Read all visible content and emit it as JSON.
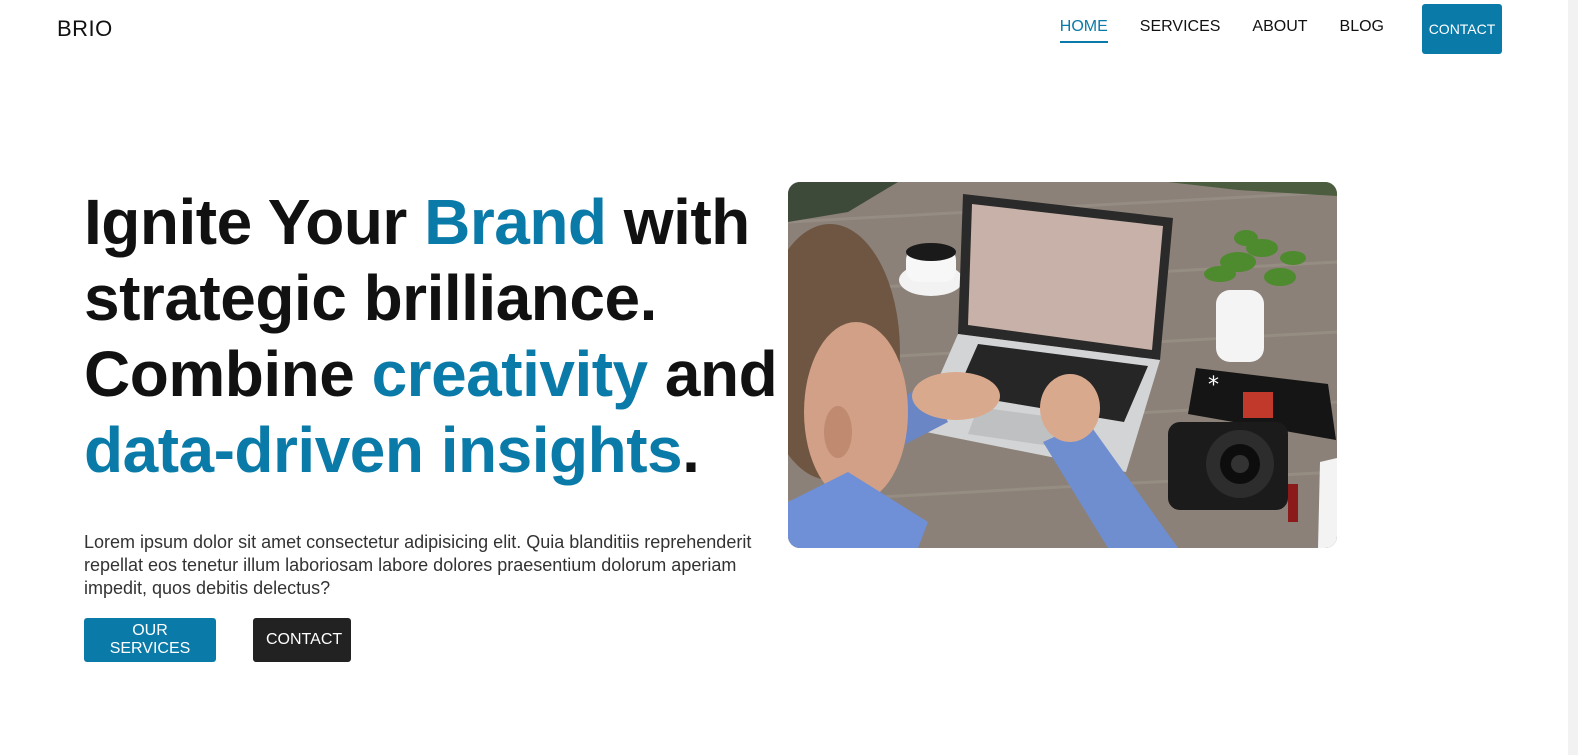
{
  "header": {
    "brand": "BRIO",
    "nav": [
      {
        "label": "HOME",
        "active": true
      },
      {
        "label": "SERVICES",
        "active": false
      },
      {
        "label": "ABOUT",
        "active": false
      },
      {
        "label": "BLOG",
        "active": false
      }
    ],
    "contact_label": "CONTACT"
  },
  "hero": {
    "heading": {
      "part1": "Ignite Your ",
      "hl1": "Brand",
      "part2": " with strategic brilliance. Combine ",
      "hl2": "creativity",
      "part3": " and ",
      "hl3": "data-driven insights",
      "part4": "."
    },
    "description": "Lorem ipsum dolor sit amet consectetur adipisicing elit. Quia blanditiis reprehenderit repellat eos tenetur illum laboriosam labore dolores praesentium dolorum aperiam impedit, quos debitis delectus?",
    "primary_button": "OUR SERVICES",
    "secondary_button": "CONTACT",
    "image_icon": "laptop-workspace-photo"
  },
  "colors": {
    "accent": "#0a7aa8",
    "dark_button": "#222222",
    "text": "#111111"
  }
}
